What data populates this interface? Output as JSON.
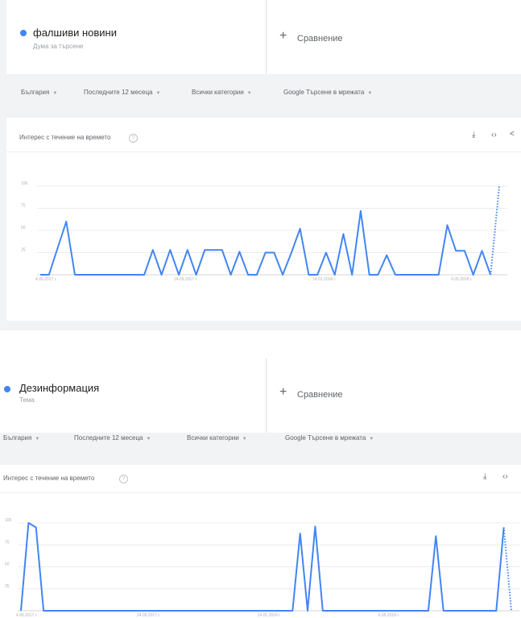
{
  "accent_color": "#4285f4",
  "panel1": {
    "term": {
      "title": "фалшиви новини",
      "subtitle": "Дума за търсене"
    },
    "compare_label": "Сравнение",
    "filters": [
      "България",
      "Последните 12 месеца",
      "Всички категории",
      "Google Търсене в мрежата"
    ],
    "card_title": "Интерес с течение на времето",
    "tools": [
      "download-icon",
      "embed-icon",
      "share-icon"
    ],
    "chart_data": {
      "type": "line",
      "ylim": [
        0,
        100
      ],
      "yticks": [
        "100",
        "75",
        "50",
        "25"
      ],
      "xtick_labels": [
        "4.06.2017 г.",
        "24.09.2017 г.",
        "14.01.2018 г.",
        "6.05.2018 г."
      ],
      "xtick_index": [
        0,
        16,
        32,
        48
      ],
      "series": [
        {
          "values": [
            0,
            0,
            30,
            60,
            0,
            0,
            0,
            0,
            0,
            0,
            0,
            0,
            0,
            28,
            0,
            28,
            0,
            28,
            0,
            28,
            28,
            28,
            0,
            26,
            0,
            0,
            25,
            25,
            0,
            25,
            52,
            0,
            0,
            25,
            0,
            46,
            0,
            72,
            0,
            0,
            22,
            0,
            0,
            0,
            0,
            0,
            0,
            56,
            27,
            27,
            0,
            27,
            0
          ],
          "partial_last": 100
        }
      ]
    }
  },
  "panel2": {
    "term": {
      "title": "Дезинформация",
      "subtitle": "Тема"
    },
    "compare_label": "Сравнение",
    "filters": [
      "България",
      "Последните 12 месеца",
      "Всички категории",
      "Google Търсене в мрежата"
    ],
    "card_title": "Интерес с течение на времето",
    "tools": [
      "download-icon",
      "embed-icon"
    ],
    "chart_data": {
      "type": "line",
      "ylim": [
        0,
        100
      ],
      "yticks": [
        "100",
        "75",
        "50",
        "25"
      ],
      "xtick_labels": [
        "4.06.2017 г.",
        "24.09.2017 г.",
        "14.01.2018 г.",
        "6.05.2018 г."
      ],
      "xtick_index": [
        0,
        16,
        32,
        48
      ],
      "series": [
        {
          "values": [
            0,
            100,
            95,
            0,
            0,
            0,
            0,
            0,
            0,
            0,
            0,
            0,
            0,
            0,
            0,
            0,
            0,
            0,
            0,
            0,
            0,
            0,
            0,
            0,
            0,
            0,
            0,
            0,
            0,
            0,
            0,
            0,
            0,
            0,
            0,
            0,
            0,
            88,
            0,
            96,
            0,
            0,
            0,
            0,
            0,
            0,
            0,
            0,
            0,
            0,
            0,
            0,
            0,
            0,
            0,
            85,
            0,
            0,
            0,
            0,
            0,
            0,
            0,
            0,
            95
          ],
          "partial_last": 0
        }
      ]
    }
  }
}
